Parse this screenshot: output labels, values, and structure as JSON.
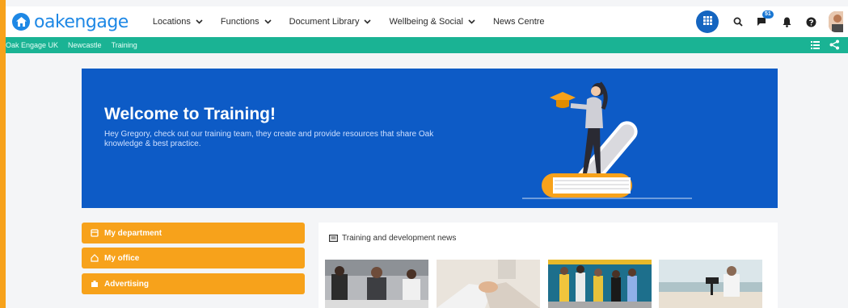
{
  "app": {
    "logo_text": "oakengage"
  },
  "nav": {
    "items": [
      {
        "label": "Locations",
        "dropdown": true
      },
      {
        "label": "Functions",
        "dropdown": true
      },
      {
        "label": "Document Library",
        "dropdown": true
      },
      {
        "label": "Wellbeing & Social",
        "dropdown": true
      },
      {
        "label": "News Centre",
        "dropdown": false
      }
    ],
    "notifications_badge": "51"
  },
  "breadcrumb": [
    "Oak Engage UK",
    "Newcastle",
    "Training"
  ],
  "hero": {
    "title": "Welcome to Training!",
    "subtitle": "Hey Gregory, check out our training team, they create and provide resources that share Oak knowledge & best practice."
  },
  "sidebar": {
    "buttons": [
      {
        "label": "My department",
        "icon": "department-icon"
      },
      {
        "label": "My office",
        "icon": "home-icon"
      },
      {
        "label": "Advertising",
        "icon": "advertising-icon"
      }
    ]
  },
  "news": {
    "title": "Training and development news"
  },
  "colors": {
    "accent_orange": "#f7a21b",
    "brand_blue": "#1e88e5",
    "breadcrumb_green": "#1ab394",
    "hero_blue": "#0d5bc6"
  }
}
